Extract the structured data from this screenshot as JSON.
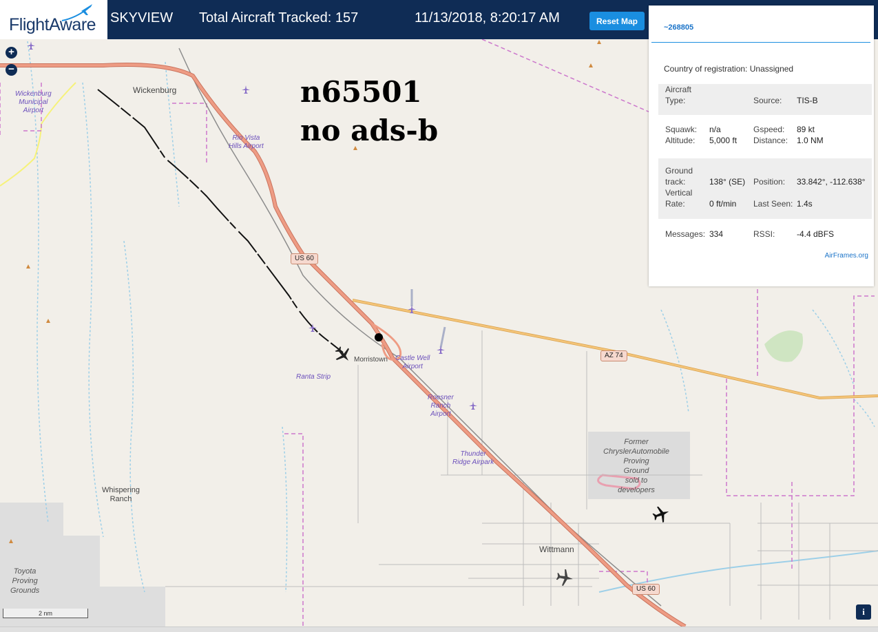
{
  "header": {
    "logo_text": "FlightAware",
    "app_name": "SKYVIEW",
    "total_tracked": "Total Aircraft Tracked: 157",
    "datetime": "11/13/2018, 8:20:17 AM",
    "reset_label": "Reset Map"
  },
  "annotation": {
    "line1": "n65501",
    "line2": "no ads-b"
  },
  "map": {
    "places": {
      "wickenburg": "Wickenburg",
      "morristown": "Morristown",
      "wittmann": "Wittmann",
      "whispering_1": "Whispering",
      "whispering_2": "Ranch"
    },
    "airports": {
      "wickenburg_1": "Wickenburg",
      "wickenburg_2": "Municipal",
      "wickenburg_3": "Airport",
      "riovista_1": "Rio Vista",
      "riovista_2": "Hills Airport",
      "castlewell_1": "Castle Well",
      "castlewell_2": "Airport",
      "ranta": "Ranta Strip",
      "roesner_1": "Roesner",
      "roesner_2": "Ranch",
      "roesner_3": "Airport",
      "thunder_1": "Thunder",
      "thunder_2": "Ridge Airpark"
    },
    "areas": {
      "chrysler_1": "Former",
      "chrysler_2": "ChryslerAutomobile",
      "chrysler_3": "Proving",
      "chrysler_4": "Ground",
      "chrysler_5": "sold to",
      "chrysler_6": "developers",
      "toyota_1": "Toyota",
      "toyota_2": "Proving",
      "toyota_3": "Grounds"
    },
    "shields": {
      "us60_north": "US 60",
      "us60_south": "US 60",
      "az74": "AZ 74"
    },
    "zoom_in": "+",
    "zoom_out": "−",
    "scale": "2 nm",
    "info": "i"
  },
  "aircraft_panel": {
    "hex": "~268805",
    "country_label": "Country of registration:",
    "country_value": "Unassigned",
    "aircraft_type_label_1": "Aircraft",
    "aircraft_type_label_2": "Type:",
    "aircraft_type_value": "",
    "source_label": "Source:",
    "source_value": "TIS-B",
    "squawk_label": "Squawk:",
    "squawk_value": "n/a",
    "gspeed_label": "Gspeed:",
    "gspeed_value": "89 kt",
    "altitude_label": "Altitude:",
    "altitude_value": "5,000 ft",
    "distance_label": "Distance:",
    "distance_value": "1.0 NM",
    "track_label_1": "Ground",
    "track_label_2": "track:",
    "track_value": "138° (SE)",
    "position_label": "Position:",
    "position_value": "33.842°, -112.638°",
    "vrate_label_1": "Vertical",
    "vrate_label_2": "Rate:",
    "vrate_value": "0 ft/min",
    "lastseen_label": "Last Seen:",
    "lastseen_value": "1.4s",
    "messages_label": "Messages:",
    "messages_value": "334",
    "rssi_label": "RSSI:",
    "rssi_value": "-4.4 dBFS",
    "airframes_link": "AirFrames.org"
  },
  "colors": {
    "header_bg": "#0f2c55",
    "accent": "#1a8ee0",
    "highway": "#e8957a",
    "state_route": "#f0b860",
    "boundary": "#cc77cc",
    "water": "#9ccfe8",
    "track": "#111111"
  }
}
